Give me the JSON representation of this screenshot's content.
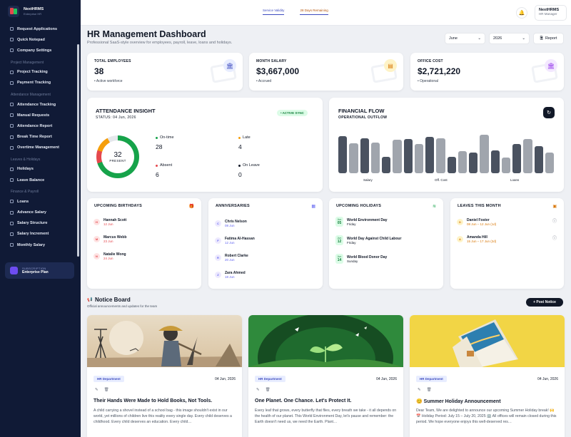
{
  "brand": {
    "name": "NextHRMS",
    "tagline": "Enterprise HR"
  },
  "sidebar": {
    "top_items": [
      "Request Applications",
      "Quick Notepad",
      "Company Settings"
    ],
    "sections": [
      {
        "title": "Project Management",
        "items": [
          "Project Tracking",
          "Payment Tracking"
        ]
      },
      {
        "title": "Attendance Management",
        "items": [
          "Attendance Tracking",
          "Manual Requests",
          "Attendance Report",
          "Break Time Report",
          "Overtime Management"
        ]
      },
      {
        "title": "Leaves & Holidays",
        "items": [
          "Holidays",
          "Leave Balance"
        ]
      },
      {
        "title": "Finance & Payroll",
        "items": [
          "Loans",
          "Advance Salary",
          "Salary Structure",
          "Salary Increment",
          "Monthly Salary"
        ]
      }
    ],
    "plan": {
      "label": "SUBSCRIPTION",
      "name": "Enterprise Plan"
    }
  },
  "topbar": {
    "tabs": [
      "Service Validity",
      "28 Days Remaining"
    ],
    "user": {
      "name": "NextHRMS",
      "role": "HR Manager"
    }
  },
  "header": {
    "title": "HR Management Dashboard",
    "subtitle": "Professional SaaS-style overview for employees, payroll, leave, loans and holidays.",
    "month": "June",
    "year": "2026",
    "report_label": "Report"
  },
  "kpis": [
    {
      "label": "TOTAL EMPLOYEES",
      "value": "38",
      "footer": "Active workforce",
      "icon": "bank-icon",
      "color": "#3d4bbf"
    },
    {
      "label": "MONTH SALARY",
      "value": "$3,667,000",
      "footer": "Accrued",
      "icon": "wallet-icon",
      "color": "#d97706"
    },
    {
      "label": "OFFICE COST",
      "value": "$2,721,220",
      "footer": "Operational",
      "icon": "building-icon",
      "color": "#9333ea"
    }
  ],
  "attendance": {
    "title": "ATTENDANCE INSIGHT",
    "status": "STATUS: 04 Jun, 2026",
    "badge": "• ACTIVE SYNC",
    "center_value": "32",
    "center_label": "PRESENT",
    "stats": [
      {
        "label": "On-time",
        "value": "28",
        "color": "#16a34a"
      },
      {
        "label": "Late",
        "value": "4",
        "color": "#f59e0b"
      },
      {
        "label": "Absent",
        "value": "6",
        "color": "#e5484d"
      },
      {
        "label": "On Leave",
        "value": "0",
        "color": "#111827"
      }
    ]
  },
  "chart_data": {
    "type": "bar",
    "title": "FINANCIAL FLOW",
    "subtitle": "OPERATIONAL OUTFLOW",
    "categories": [
      "Salary",
      "Off. Cost",
      "Loans"
    ],
    "values": [
      0.9,
      0.73,
      0.85,
      0.75,
      0.39,
      0.81,
      0.83,
      0.7,
      0.88,
      0.85,
      0.4,
      0.53,
      0.5,
      0.93,
      0.55,
      0.38,
      0.7,
      0.83,
      0.65,
      0.5
    ]
  },
  "birthdays": {
    "title": "UPCOMING BIRTHDAYS",
    "items": [
      {
        "i": "H",
        "name": "Hannah Scott",
        "sub": "12 Jun"
      },
      {
        "i": "M",
        "name": "Marcus Webb",
        "sub": "23 Jun"
      },
      {
        "i": "N",
        "name": "Natalie Wong",
        "sub": "24 Jun"
      }
    ]
  },
  "anniversaries": {
    "title": "ANNIVERSARIES",
    "items": [
      {
        "i": "C",
        "name": "Chris Nelson",
        "sub": "08 Jun"
      },
      {
        "i": "F",
        "name": "Fatima Al-Hassan",
        "sub": "12 Jun"
      },
      {
        "i": "R",
        "name": "Robert Clarke",
        "sub": "20 Jun"
      },
      {
        "i": "Z",
        "name": "Zara Ahmed",
        "sub": "18 Jun"
      }
    ]
  },
  "holidays": {
    "title": "UPCOMING HOLIDAYS",
    "items": [
      {
        "m": "Jun",
        "d": "05",
        "name": "World Environment Day",
        "sub": "Friday"
      },
      {
        "m": "Jun",
        "d": "12",
        "name": "World Day Against Child Labour",
        "sub": "Friday"
      },
      {
        "m": "Jun",
        "d": "14",
        "name": "World Blood Donor Day",
        "sub": "Sunday"
      }
    ]
  },
  "leaves": {
    "title": "LEAVES THIS MONTH",
    "items": [
      {
        "i": "D",
        "name": "Daniel Foster",
        "sub": "08 Jun – 12 Jun (1d)"
      },
      {
        "i": "A",
        "name": "Amanda Hill",
        "sub": "15 Jun – 17 Jun (2d)"
      }
    ]
  },
  "notice": {
    "title": "Notice Board",
    "subtitle": "Official announcements and updates for the team",
    "post_label": "+ Post Notice",
    "cards": [
      {
        "dept": "HR Department",
        "date": "04 Jun, 2026",
        "title": "Their Hands Were Made to Hold Books, Not Tools.",
        "body": "A child carrying a shovel instead of a school bag - this image shouldn't exist in our world, yet millions of children live this reality every single day. Every child deserves a childhood. Every child deserves an education. Every child…"
      },
      {
        "dept": "HR Department",
        "date": "04 Jun, 2026",
        "title": "One Planet. One Chance. Let's Protect It.",
        "body": "Every leaf that grows, every butterfly that flies, every breath we take - it all depends on the health of our planet. This World Environment Day, let's pause and remember: the Earth doesn't need us, we need the Earth. Plant…"
      },
      {
        "dept": "HR Department",
        "date": "04 Jun, 2026",
        "title": "😊 Summer Holiday Announcement",
        "body": "Dear Team, We are delighted to announce our upcoming Summer Holiday break! 🙌📅 Holiday Period: July 15 – July 20, 2025 🏢 All offices will remain closed during this period. We hope everyone enjoys this well-deserved res…"
      }
    ]
  }
}
